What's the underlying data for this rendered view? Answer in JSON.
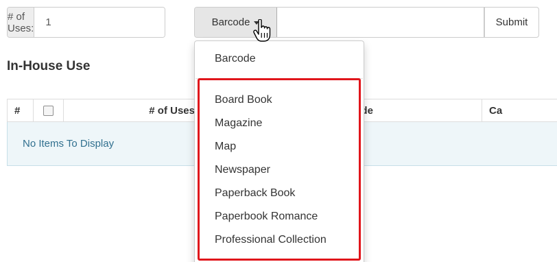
{
  "form": {
    "uses_label": "# of Uses:",
    "uses_value": "1",
    "type_selected": "Barcode",
    "search_value": "",
    "submit_label": "Submit"
  },
  "section": {
    "title": "In-House Use"
  },
  "table": {
    "columns": [
      "#",
      "",
      "# of Uses",
      "rcode",
      "Ca"
    ],
    "empty_message": "No Items To Display"
  },
  "dropdown": {
    "items": [
      "Barcode",
      "Board Book",
      "Magazine",
      "Map",
      "Newspaper",
      "Paperback Book",
      "Paperbook Romance",
      "Professional Collection"
    ],
    "highlight_color": "#e0151b"
  },
  "icons": {
    "cursor": "hand-pointer-icon",
    "caret": "caret-down-icon"
  }
}
